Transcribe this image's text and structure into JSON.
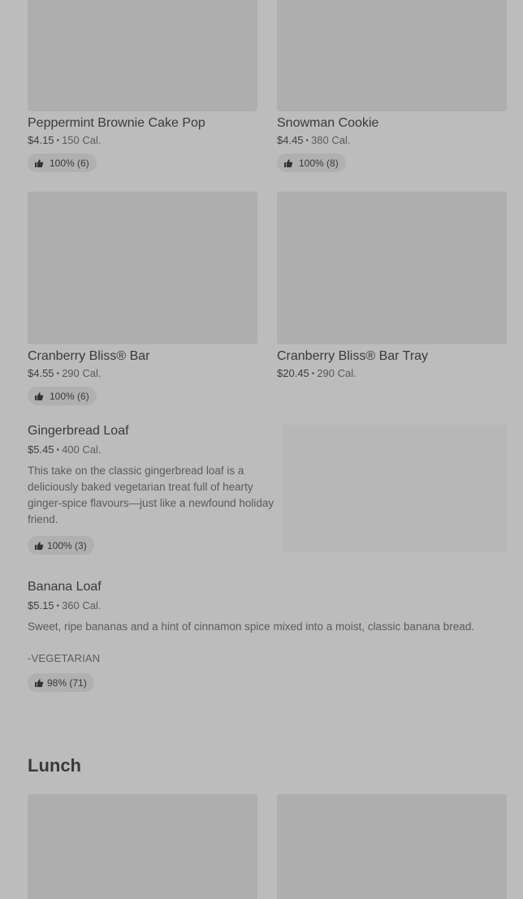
{
  "items": [
    {
      "name": "Peppermint Brownie Cake Pop",
      "price": "$4.15",
      "calories": "150 Cal.",
      "rating": "100% (6)"
    },
    {
      "name": "Snowman Cookie",
      "price": "$4.45",
      "calories": "380 Cal.",
      "rating": "100% (8)"
    },
    {
      "name": "Cranberry Bliss® Bar",
      "price": "$4.55",
      "calories": "290 Cal.",
      "rating": "100% (6)"
    },
    {
      "name": "Cranberry Bliss® Bar Tray",
      "price": "$20.45",
      "calories": "290 Cal."
    },
    {
      "name": "Gingerbread Loaf",
      "price": "$5.45",
      "calories": "400 Cal.",
      "description": "This take on the classic gingerbread loaf is a deliciously baked vegetarian treat full of hearty ginger-spice flavours—just like a newfound holiday friend.",
      "rating": "100% (3)"
    },
    {
      "name": "Banana Loaf",
      "price": "$5.15",
      "calories": "360 Cal.",
      "description": "Sweet, ripe bananas and a hint of cinnamon spice mixed into a moist, classic banana bread.",
      "tag": "-VEGETARIAN",
      "rating": "98% (71)"
    }
  ],
  "separator": "•",
  "sections": {
    "lunch": "Lunch"
  },
  "icons": {
    "rating": "thumbs-up-icon"
  },
  "colors": {
    "background": "#bcbcbc",
    "image_placeholder": "#aeaeae",
    "pill": "#b0b0b0",
    "text": "#3a3a3a"
  }
}
